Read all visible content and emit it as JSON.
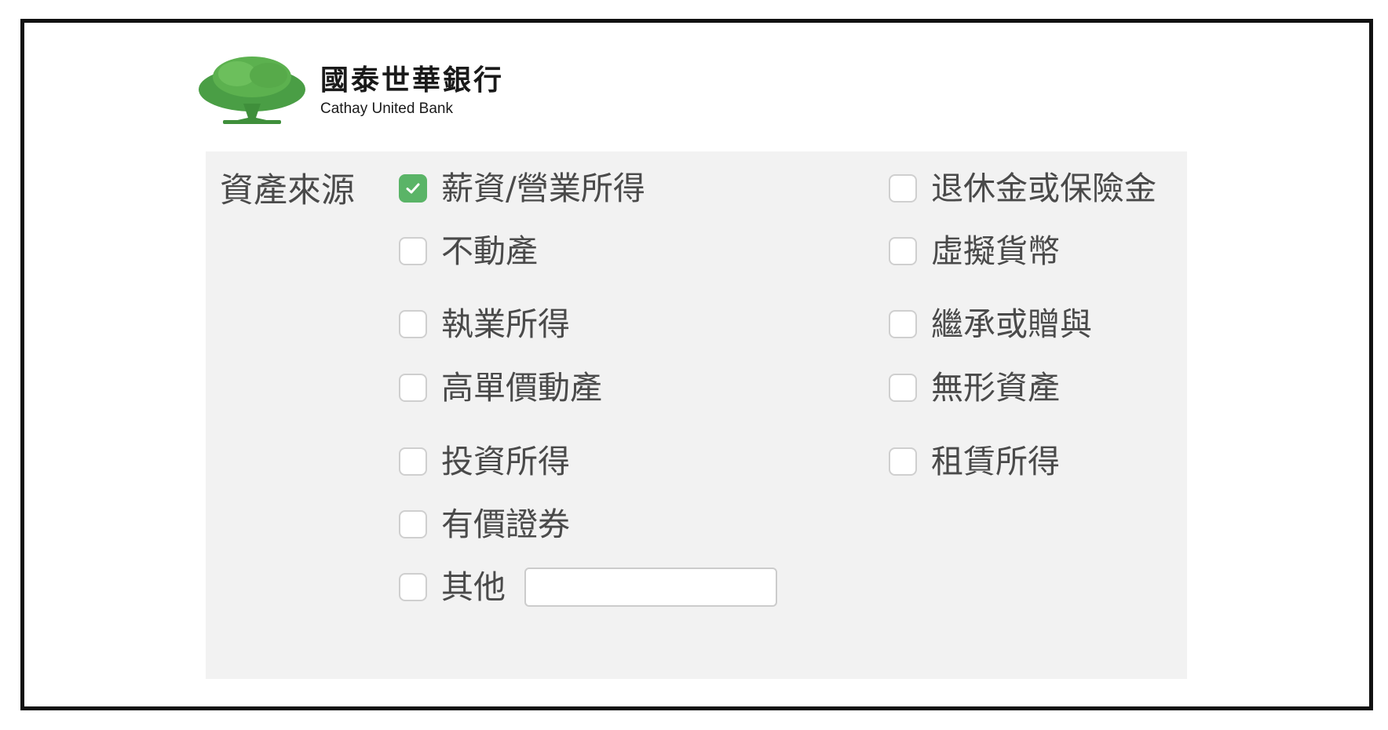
{
  "brand": {
    "name_zh": "國泰世華銀行",
    "name_en": "Cathay United Bank",
    "logo_color": "#4a9e45"
  },
  "form": {
    "field_label": "資產來源",
    "accent_color": "#5ab467",
    "options": [
      {
        "label": "薪資/營業所得",
        "checked": true
      },
      {
        "label": "退休金或保險金",
        "checked": false
      },
      {
        "label": "不動產",
        "checked": false
      },
      {
        "label": "虛擬貨幣",
        "checked": false
      },
      {
        "label": "執業所得",
        "checked": false
      },
      {
        "label": "繼承或贈與",
        "checked": false
      },
      {
        "label": "高單價動產",
        "checked": false
      },
      {
        "label": "無形資產",
        "checked": false
      },
      {
        "label": "投資所得",
        "checked": false
      },
      {
        "label": "租賃所得",
        "checked": false
      },
      {
        "label": "有價證券",
        "checked": false
      },
      {
        "label": "其他",
        "checked": false
      }
    ],
    "other_input": {
      "value": "",
      "placeholder": ""
    }
  }
}
